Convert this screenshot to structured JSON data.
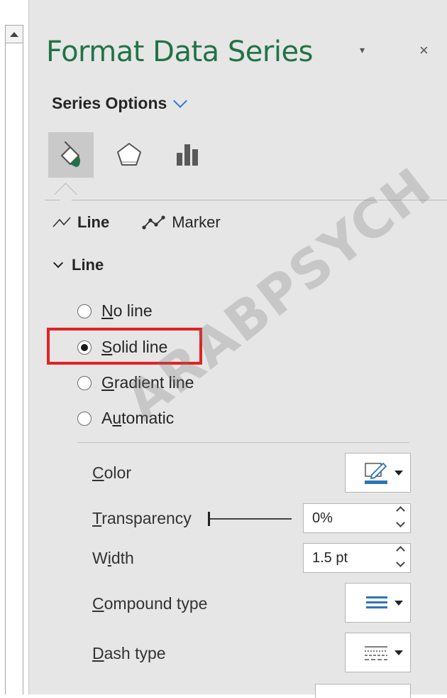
{
  "pane": {
    "title": "Format Data Series",
    "menu_glyph": "▾",
    "close_glyph": "×"
  },
  "series_options": {
    "label": "Series Options"
  },
  "tabs": [
    {
      "icon": "fill-line-icon",
      "active": true
    },
    {
      "icon": "effects-pentagon-icon",
      "active": false
    },
    {
      "icon": "series-options-bar-chart-icon",
      "active": false
    }
  ],
  "subtabs": {
    "line": "Line",
    "marker": "Marker"
  },
  "line_section": {
    "heading": "Line"
  },
  "radio_options": [
    {
      "label": "No line",
      "accel_index": 0,
      "checked": false
    },
    {
      "label": "Solid line",
      "accel_index": 0,
      "checked": true
    },
    {
      "label": "Gradient line",
      "accel_index": 0,
      "checked": false
    },
    {
      "label": "Automatic",
      "accel_index": 1,
      "checked": false
    }
  ],
  "properties": {
    "color": {
      "label": "Color",
      "accel_index": 0,
      "swatch": "#2e75b6"
    },
    "transparency": {
      "label": "Transparency",
      "accel_index": 0,
      "value": "0%"
    },
    "width": {
      "label": "Width",
      "accel_index": 1,
      "value": "1.5 pt"
    },
    "compound_type": {
      "label": "Compound type",
      "accel_index": 0
    },
    "dash_type": {
      "label": "Dash type",
      "accel_index": 0
    }
  },
  "watermark": "ARABPSYCH",
  "colors": {
    "title_green": "#217346",
    "accent_blue": "#2b79d0",
    "highlight_red": "#e32222"
  }
}
